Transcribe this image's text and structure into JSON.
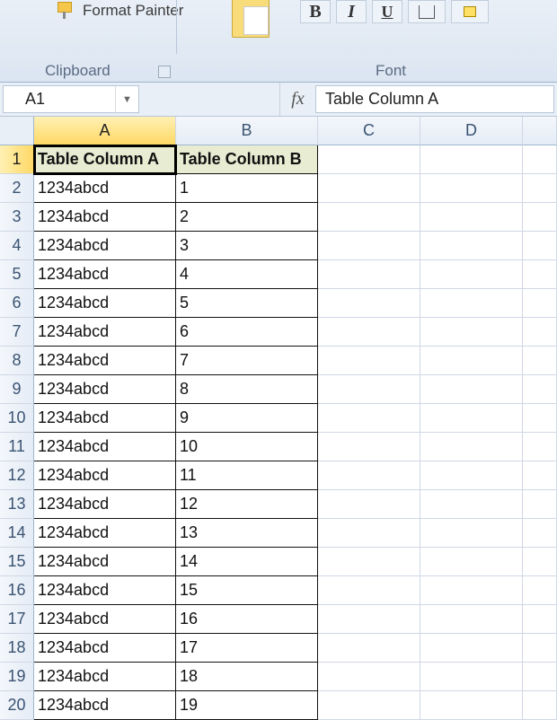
{
  "ribbon": {
    "format_painter": "Format Painter",
    "clipboard_group": "Clipboard",
    "font_group": "Font",
    "bold": "B",
    "italic": "I",
    "underline": "U"
  },
  "name_box": "A1",
  "fx_label": "fx",
  "formula_bar": "Table Column A",
  "columns": [
    "A",
    "B",
    "C",
    "D",
    ""
  ],
  "selected_column_index": 0,
  "selected_row_index": 0,
  "rows": [
    {
      "n": 1,
      "a": "Table Column A",
      "b": "Table Column B",
      "header": true
    },
    {
      "n": 2,
      "a": "1234abcd",
      "b": "1"
    },
    {
      "n": 3,
      "a": "1234abcd",
      "b": "2"
    },
    {
      "n": 4,
      "a": "1234abcd",
      "b": "3"
    },
    {
      "n": 5,
      "a": "1234abcd",
      "b": "4"
    },
    {
      "n": 6,
      "a": "1234abcd",
      "b": "5"
    },
    {
      "n": 7,
      "a": "1234abcd",
      "b": "6"
    },
    {
      "n": 8,
      "a": "1234abcd",
      "b": "7"
    },
    {
      "n": 9,
      "a": "1234abcd",
      "b": "8"
    },
    {
      "n": 10,
      "a": "1234abcd",
      "b": "9"
    },
    {
      "n": 11,
      "a": "1234abcd",
      "b": "10"
    },
    {
      "n": 12,
      "a": "1234abcd",
      "b": "11"
    },
    {
      "n": 13,
      "a": "1234abcd",
      "b": "12"
    },
    {
      "n": 14,
      "a": "1234abcd",
      "b": "13"
    },
    {
      "n": 15,
      "a": "1234abcd",
      "b": "14"
    },
    {
      "n": 16,
      "a": "1234abcd",
      "b": "15"
    },
    {
      "n": 17,
      "a": "1234abcd",
      "b": "16"
    },
    {
      "n": 18,
      "a": "1234abcd",
      "b": "17"
    },
    {
      "n": 19,
      "a": "1234abcd",
      "b": "18"
    },
    {
      "n": 20,
      "a": "1234abcd",
      "b": "19"
    }
  ]
}
